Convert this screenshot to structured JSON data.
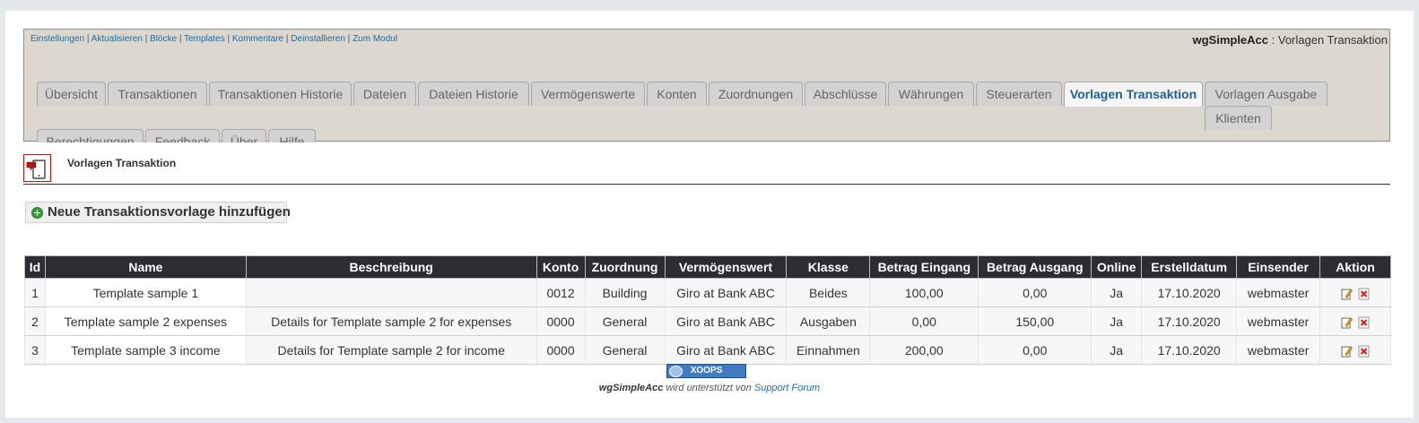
{
  "admin_links": [
    "Einstellungen",
    "Aktualisieren",
    "Blöcke",
    "Templates",
    "Kommentare",
    "Deinstallieren",
    "Zum Modul"
  ],
  "link_separator": "|",
  "module": {
    "name": "wgSimpleAcc",
    "separator": " : ",
    "page": "Vorlagen Transaktion"
  },
  "tabs": [
    "Übersicht",
    "Transaktionen",
    "Transaktionen Historie",
    "Dateien",
    "Dateien Historie",
    "Vermögenswerte",
    "Konten",
    "Zuordnungen",
    "Abschlüsse",
    "Währungen",
    "Steuerarten",
    "Vorlagen Transaktion",
    "Vorlagen Ausgabe",
    "Klienten",
    "Berechtigungen",
    "Feedback",
    "Über",
    "Hilfe"
  ],
  "active_tab": "Vorlagen Transaktion",
  "page_title": "Vorlagen Transaktion",
  "add_button": "Neue Transaktionsvorlage hinzufügen",
  "table": {
    "columns": [
      "Id",
      "Name",
      "Beschreibung",
      "Konto",
      "Zuordnung",
      "Vermögenswert",
      "Klasse",
      "Betrag Eingang",
      "Betrag Ausgang",
      "Online",
      "Erstelldatum",
      "Einsender",
      "Aktion"
    ],
    "rows": [
      {
        "id": "1",
        "name": "Template sample 1",
        "description": "",
        "konto": "0012",
        "zuordnung": "Building",
        "vermoegenswert": "Giro at Bank ABC",
        "klasse": "Beides",
        "eingang": "100,00",
        "ausgang": "0,00",
        "online": "Ja",
        "datum": "17.10.2020",
        "einsender": "webmaster"
      },
      {
        "id": "2",
        "name": "Template sample 2 expenses",
        "description": "Details for Template sample 2 for expenses",
        "konto": "0000",
        "zuordnung": "General",
        "vermoegenswert": "Giro at Bank ABC",
        "klasse": "Ausgaben",
        "eingang": "0,00",
        "ausgang": "150,00",
        "online": "Ja",
        "datum": "17.10.2020",
        "einsender": "webmaster"
      },
      {
        "id": "3",
        "name": "Template sample 3 income",
        "description": "Details for Template sample 2 for income",
        "konto": "0000",
        "zuordnung": "General",
        "vermoegenswert": "Giro at Bank ABC",
        "klasse": "Einnahmen",
        "eingang": "200,00",
        "ausgang": "0,00",
        "online": "Ja",
        "datum": "17.10.2020",
        "einsender": "webmaster"
      }
    ]
  },
  "icons": {
    "edit": "edit-icon",
    "delete": "delete-icon",
    "page": "page-icon",
    "add": "add-icon"
  },
  "colors": {
    "accent": "#1f5f94",
    "link": "#1d6fa5",
    "header_dark": "#2b2d33",
    "delete_red": "#d81f1f"
  },
  "footer": {
    "logo_text": "XOOPS",
    "module_name": "wgSimpleAcc",
    "support_text": " wird unterstützt von ",
    "support_link": "Support Forum"
  }
}
